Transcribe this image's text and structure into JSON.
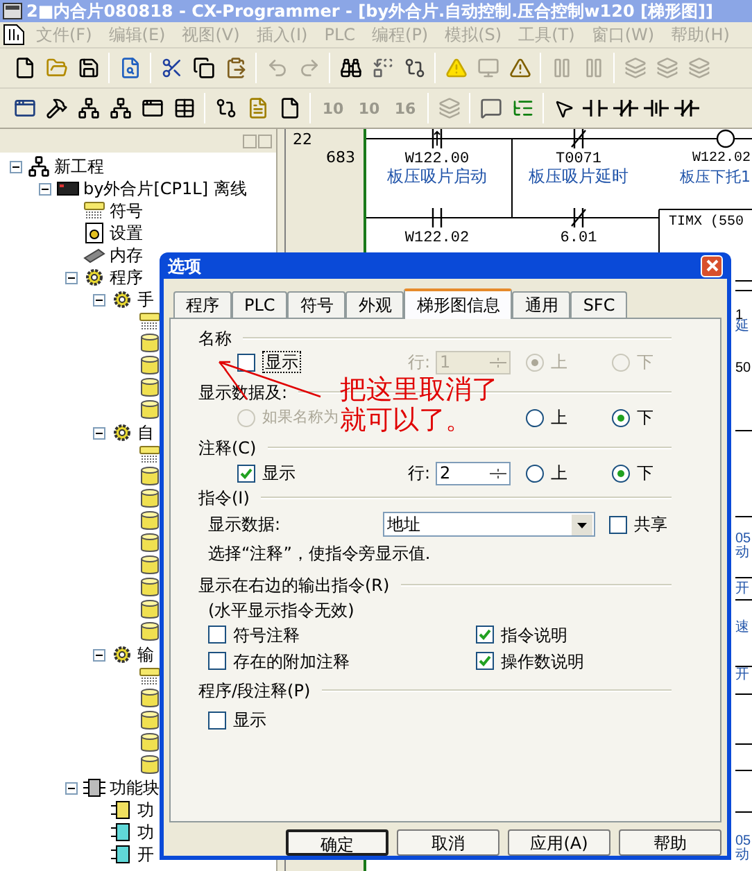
{
  "window": {
    "title": "2■内合片080818 - CX-Programmer - [by外合片.自动控制.压合控制w120 [梯形图]]"
  },
  "menu": [
    "文件(F)",
    "编辑(E)",
    "视图(V)",
    "插入(I)",
    "PLC",
    "编程(P)",
    "模拟(S)",
    "工具(T)",
    "窗口(W)",
    "帮助(H)"
  ],
  "toolbar": {
    "number_buttons": [
      "10",
      "10",
      "16"
    ]
  },
  "tree": [
    {
      "label": "新工程",
      "kind": "project",
      "expanded": true,
      "children": [
        {
          "label": "by外合片[CP1L] 离线",
          "kind": "plc",
          "expanded": true,
          "children": [
            {
              "label": "符号",
              "kind": "symbols"
            },
            {
              "label": "设置",
              "kind": "settings"
            },
            {
              "label": "内存",
              "kind": "memory"
            },
            {
              "label": "程序",
              "kind": "programs",
              "expanded": true,
              "children": [
                {
                  "label": "手",
                  "kind": "program",
                  "expanded": true,
                  "children": [
                    {
                      "kind": "symbols"
                    },
                    {
                      "kind": "section"
                    },
                    {
                      "kind": "section"
                    },
                    {
                      "kind": "section"
                    },
                    {
                      "kind": "section"
                    }
                  ]
                },
                {
                  "label": "自",
                  "kind": "program",
                  "expanded": true,
                  "children": [
                    {
                      "kind": "symbols"
                    },
                    {
                      "kind": "section"
                    },
                    {
                      "kind": "section"
                    },
                    {
                      "kind": "section"
                    },
                    {
                      "kind": "section"
                    },
                    {
                      "kind": "section"
                    },
                    {
                      "kind": "section"
                    },
                    {
                      "kind": "section"
                    },
                    {
                      "kind": "section"
                    }
                  ]
                },
                {
                  "label": "输",
                  "kind": "program",
                  "expanded": true,
                  "children": [
                    {
                      "kind": "symbols"
                    },
                    {
                      "kind": "section"
                    },
                    {
                      "kind": "section"
                    },
                    {
                      "kind": "section"
                    },
                    {
                      "kind": "section"
                    }
                  ]
                }
              ]
            },
            {
              "label": "功能块",
              "kind": "function_blocks",
              "expanded": true,
              "children": [
                {
                  "label": "功",
                  "kind": "fb_ladder"
                },
                {
                  "label": "功",
                  "kind": "fb_text"
                },
                {
                  "label": "开",
                  "kind": "fb_text"
                }
              ]
            }
          ]
        }
      ]
    }
  ],
  "ladder": {
    "rung": "22",
    "step": "683",
    "elements": [
      {
        "kind": "contact_rising",
        "address": "W122.00",
        "comment": "板压吸片启动"
      },
      {
        "kind": "contact_nc",
        "address": "T0071",
        "comment": "板压吸片延时"
      },
      {
        "kind": "coil",
        "address": "W122.02",
        "comment": "板压下托1"
      },
      {
        "kind": "contact_no",
        "address": "W122.02"
      },
      {
        "kind": "contact_nc",
        "address": "6.01"
      },
      {
        "kind": "timer",
        "address": "TIMX (550"
      }
    ],
    "edge_fragments": [
      "1",
      "延",
      "50",
      "05",
      "动",
      "开",
      "速",
      "开",
      "05",
      "动"
    ]
  },
  "dialog": {
    "title": "选项",
    "tabs": [
      {
        "label": "程序",
        "selected": false
      },
      {
        "label": "PLC",
        "selected": false
      },
      {
        "label": "符号",
        "selected": false
      },
      {
        "label": "外观",
        "selected": false
      },
      {
        "label": "梯形图信息",
        "selected": true
      },
      {
        "label": "通用",
        "selected": false
      },
      {
        "label": "SFC",
        "selected": false
      }
    ],
    "name_group": {
      "heading": "名称",
      "show": {
        "label": "显示",
        "checked": false
      },
      "row": {
        "label": "行:",
        "value": "1",
        "disabled": true
      },
      "above": {
        "label": "上",
        "selected": true,
        "disabled": true
      },
      "below": {
        "label": "下",
        "selected": false,
        "disabled": true
      }
    },
    "display_group": {
      "heading": "显示数据及:",
      "option": {
        "label": "如果名称为",
        "selected": false,
        "disabled": true
      },
      "above": {
        "label": "上",
        "selected": false,
        "disabled": false
      },
      "below": {
        "label": "下",
        "selected": true,
        "disabled": false
      }
    },
    "comment_group": {
      "heading": "注释(C)",
      "show": {
        "label": "显示",
        "checked": true
      },
      "row": {
        "label": "行:",
        "value": "2",
        "disabled": false
      },
      "above": {
        "label": "上",
        "selected": false,
        "disabled": false
      },
      "below": {
        "label": "下",
        "selected": true,
        "disabled": false
      }
    },
    "instruction_group": {
      "heading": "指令(I)",
      "data_label": "显示数据:",
      "data_value": "地址",
      "shared": {
        "label": "共享",
        "checked": false
      },
      "hint": "选择“注释”，使指令旁显示值."
    },
    "output_group": {
      "heading": "显示在右边的输出指令(R)",
      "note": "(水平显示指令无效)",
      "options": [
        {
          "label": "符号注释",
          "checked": false
        },
        {
          "label": "存在的附加注释",
          "checked": false
        },
        {
          "label": "指令说明",
          "checked": true
        },
        {
          "label": "操作数说明",
          "checked": true
        }
      ]
    },
    "section_group": {
      "heading": "程序/段注释(P)",
      "show": {
        "label": "显示",
        "checked": false
      }
    },
    "buttons": [
      {
        "label": "确定",
        "default": true
      },
      {
        "label": "取消",
        "default": false
      },
      {
        "label": "应用(A)",
        "default": false
      },
      {
        "label": "帮助",
        "default": false
      }
    ],
    "annotation": [
      "把这里取消了",
      "就可以了。"
    ]
  }
}
